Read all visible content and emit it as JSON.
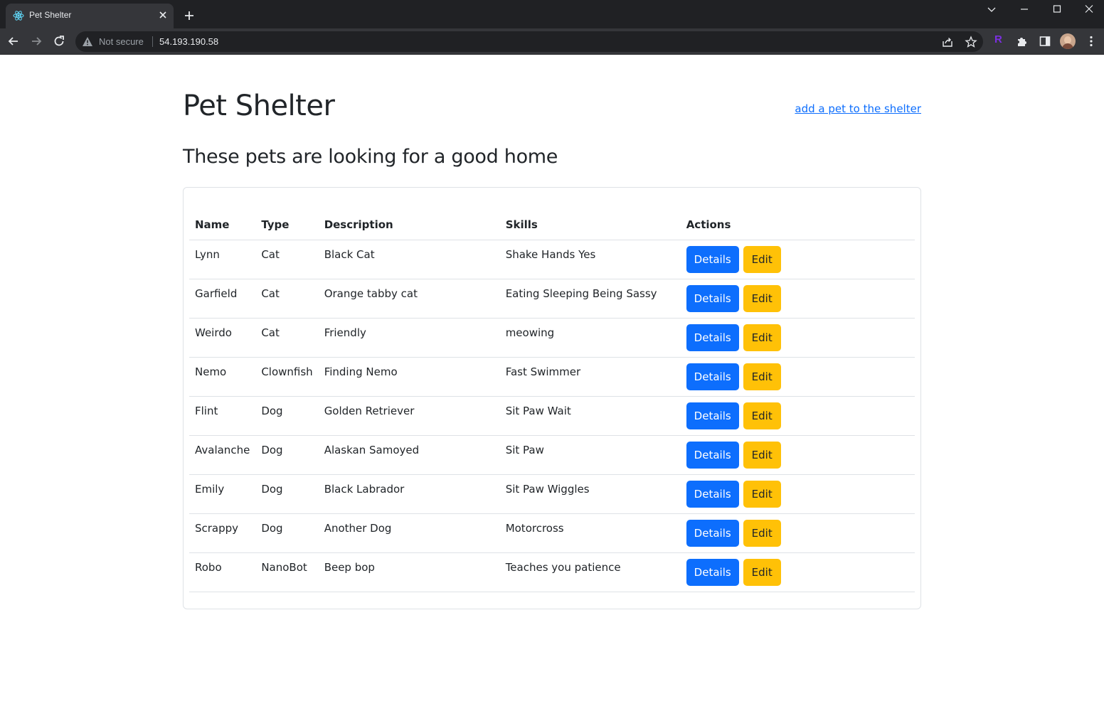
{
  "browser": {
    "tab_title": "Pet Shelter",
    "security_label": "Not secure",
    "url": "54.193.190.58",
    "extension_letter": "R"
  },
  "page": {
    "title": "Pet Shelter",
    "add_link": "add a pet to the shelter",
    "subtitle": "These pets are looking for a good home"
  },
  "table": {
    "headers": [
      "Name",
      "Type",
      "Description",
      "Skills",
      "Actions"
    ],
    "rows": [
      {
        "name": "Lynn",
        "type": "Cat",
        "description": "Black Cat",
        "skills": "Shake Hands Yes"
      },
      {
        "name": "Garfield",
        "type": "Cat",
        "description": "Orange tabby cat",
        "skills": "Eating Sleeping Being Sassy"
      },
      {
        "name": "Weirdo",
        "type": "Cat",
        "description": "Friendly",
        "skills": "meowing"
      },
      {
        "name": "Nemo",
        "type": "Clownfish",
        "description": "Finding Nemo",
        "skills": "Fast Swimmer"
      },
      {
        "name": "Flint",
        "type": "Dog",
        "description": "Golden Retriever",
        "skills": "Sit Paw Wait"
      },
      {
        "name": "Avalanche",
        "type": "Dog",
        "description": "Alaskan Samoyed",
        "skills": "Sit Paw"
      },
      {
        "name": "Emily",
        "type": "Dog",
        "description": "Black Labrador",
        "skills": "Sit Paw Wiggles"
      },
      {
        "name": "Scrappy",
        "type": "Dog",
        "description": "Another Dog",
        "skills": "Motorcross"
      },
      {
        "name": "Robo",
        "type": "NanoBot",
        "description": "Beep bop",
        "skills": "Teaches you patience"
      }
    ],
    "details_label": "Details",
    "edit_label": "Edit"
  },
  "colors": {
    "primary": "#0d6efd",
    "warning": "#ffc107",
    "text": "#212529",
    "border": "#dee2e6",
    "chrome_dark": "#202124",
    "chrome_toolbar": "#35363a"
  },
  "icons": [
    "react-icon",
    "close-icon",
    "plus-icon",
    "chevron-down-icon",
    "minimize-icon",
    "maximize-icon",
    "back-arrow-icon",
    "forward-arrow-icon",
    "reload-icon",
    "warning-icon",
    "share-icon",
    "star-icon",
    "puzzle-icon",
    "sidepanel-icon",
    "more-vert-icon"
  ]
}
